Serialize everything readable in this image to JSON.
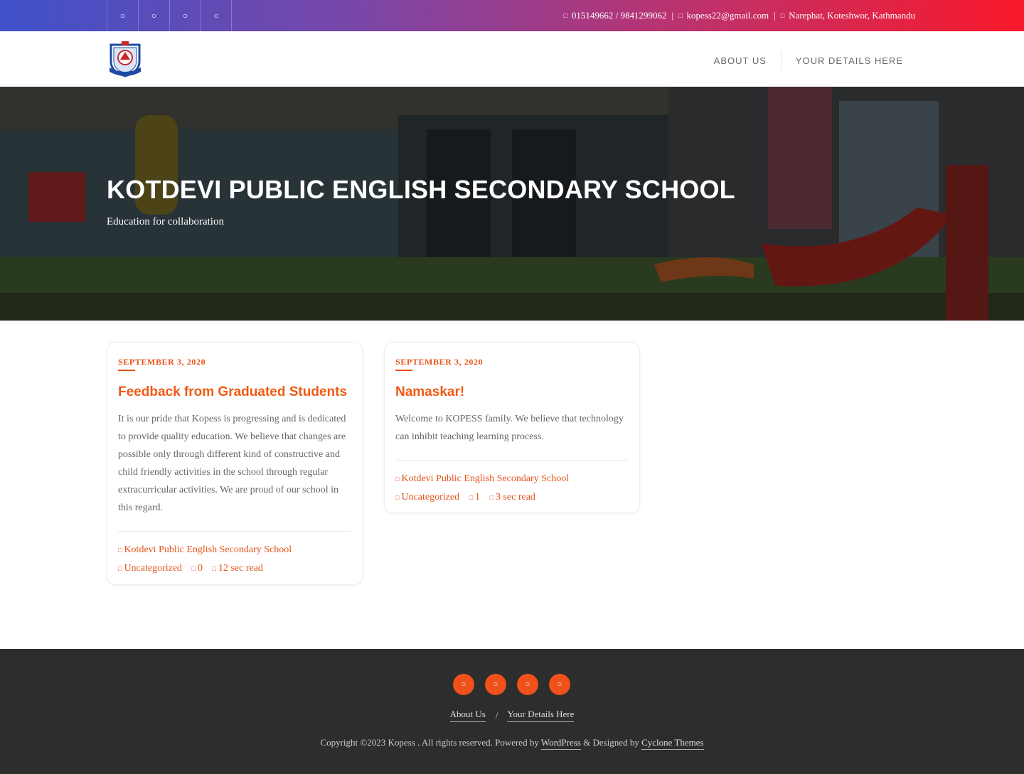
{
  "topbar": {
    "social_icons": [
      "facebook-icon",
      "twitter-icon",
      "instagram-icon",
      "youtube-icon"
    ],
    "phone": "015149662 / 9841299062",
    "email": "kopess22@gmail.com",
    "address": "Narephat, Koteshwor, Kathmandu",
    "separator": "|"
  },
  "header": {
    "nav": [
      "About Us",
      "Your Details Here"
    ]
  },
  "hero": {
    "title": "Kotdevi Public English Secondary School",
    "tagline": "Education for collaboration"
  },
  "posts": [
    {
      "date": "September 3, 2020",
      "title": "Feedback from Graduated Students",
      "excerpt": "It is our pride that Kopess is progressing and is dedicated to provide quality education. We believe that changes are possible only through different kind of constructive and child friendly activities in the school through regular extracurricular activities. We are proud of our school in this regard.",
      "author": "Kotdevi Public English Secondary School",
      "category": "Uncategorized",
      "comments": "0",
      "read_time": "12 sec read"
    },
    {
      "date": "September 3, 2020",
      "title": "Namaskar!",
      "excerpt": "Welcome to KOPESS family. We believe that technology can inhibit teaching learning process.",
      "author": "Kotdevi Public English Secondary School",
      "category": "Uncategorized",
      "comments": "1",
      "read_time": "3 sec read"
    }
  ],
  "footer": {
    "social_icons": [
      "facebook-icon",
      "twitter-icon",
      "instagram-icon",
      "youtube-icon"
    ],
    "menu": [
      "About Us",
      "Your Details Here"
    ],
    "menu_separator": "/",
    "copyright_prefix": "Copyright ©2023 Kopess . All rights reserved. Powered by",
    "powered_link": "WordPress",
    "designed_text": "& Designed by",
    "designer_link": "Cyclone Themes"
  },
  "colors": {
    "accent": "#f05a14",
    "footer_bg": "#2d2d2d",
    "topbar_gradient": [
      "#3f51c9",
      "#f8192a"
    ]
  }
}
